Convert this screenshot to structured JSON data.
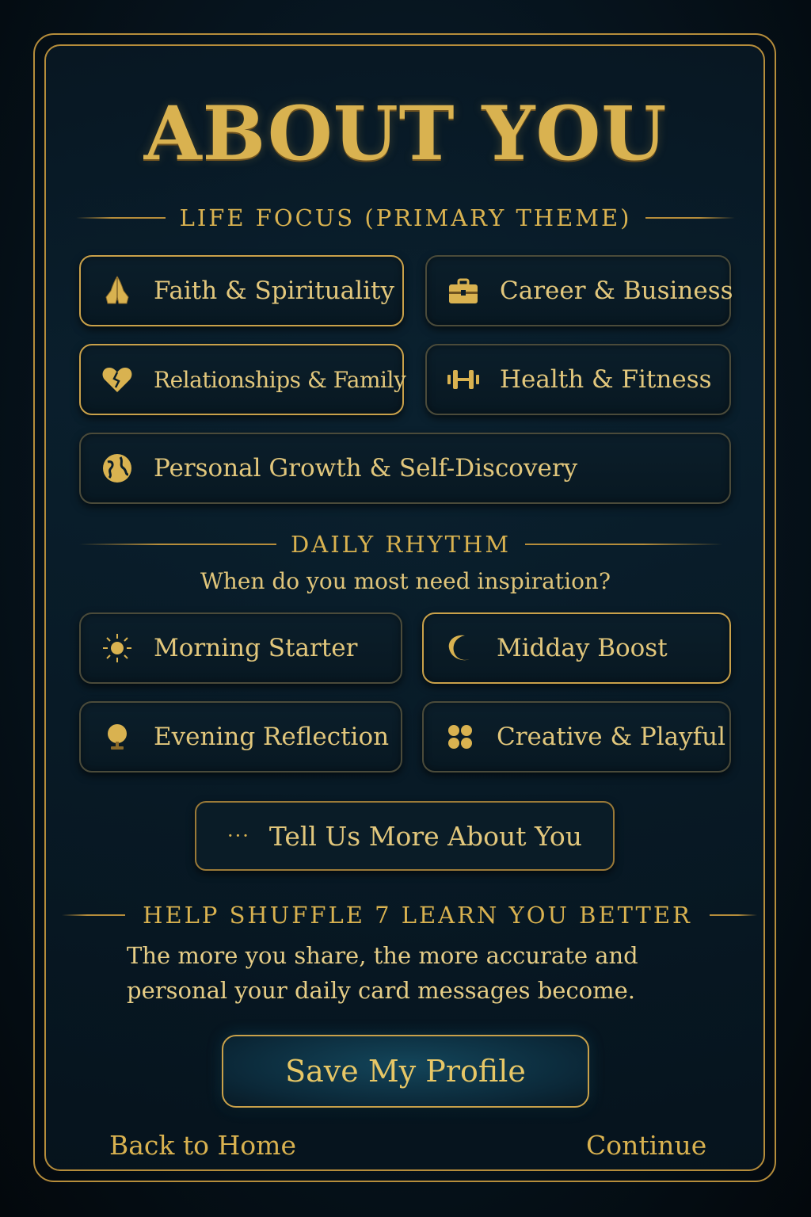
{
  "title": "ABOUT YOU",
  "life_focus": {
    "header": "LIFE FOCUS (PRIMARY THEME)",
    "options": [
      {
        "label": "Faith & Spirituality",
        "icon": "praying-hands-icon",
        "selected": true
      },
      {
        "label": "Career & Business",
        "icon": "briefcase-icon",
        "selected": false
      },
      {
        "label": "Relationships & Family",
        "icon": "heart-icon",
        "selected": true
      },
      {
        "label": "Health & Fitness",
        "icon": "dumbbell-icon",
        "selected": false
      },
      {
        "label": "Personal Growth & Self-Discovery",
        "icon": "globe-icon",
        "selected": false
      }
    ]
  },
  "daily_rhythm": {
    "header": "DAILY RHYTHM",
    "question": "When do you most need inspiration?",
    "options": [
      {
        "label": "Morning Starter",
        "icon": "sun-icon"
      },
      {
        "label": "Midday Boost",
        "icon": "moon-icon"
      },
      {
        "label": "Evening Reflection",
        "icon": "lamp-icon"
      },
      {
        "label": "Creative & Playful",
        "icon": "flower-icon"
      }
    ]
  },
  "tell_more": {
    "dots": "···",
    "label": "Tell Us More About You"
  },
  "help": {
    "header": "HELP SHUFFLE 7 LEARN YOU BETTER",
    "line1": "The more you share, the more accurate and",
    "line2": "personal your daily card messages become."
  },
  "save_button": "Save My Profile",
  "footer": {
    "back": "Back to Home",
    "continue": "Continue"
  },
  "colors": {
    "gold": "#d9b250",
    "background": "#071621",
    "border": "#b68d3b"
  }
}
